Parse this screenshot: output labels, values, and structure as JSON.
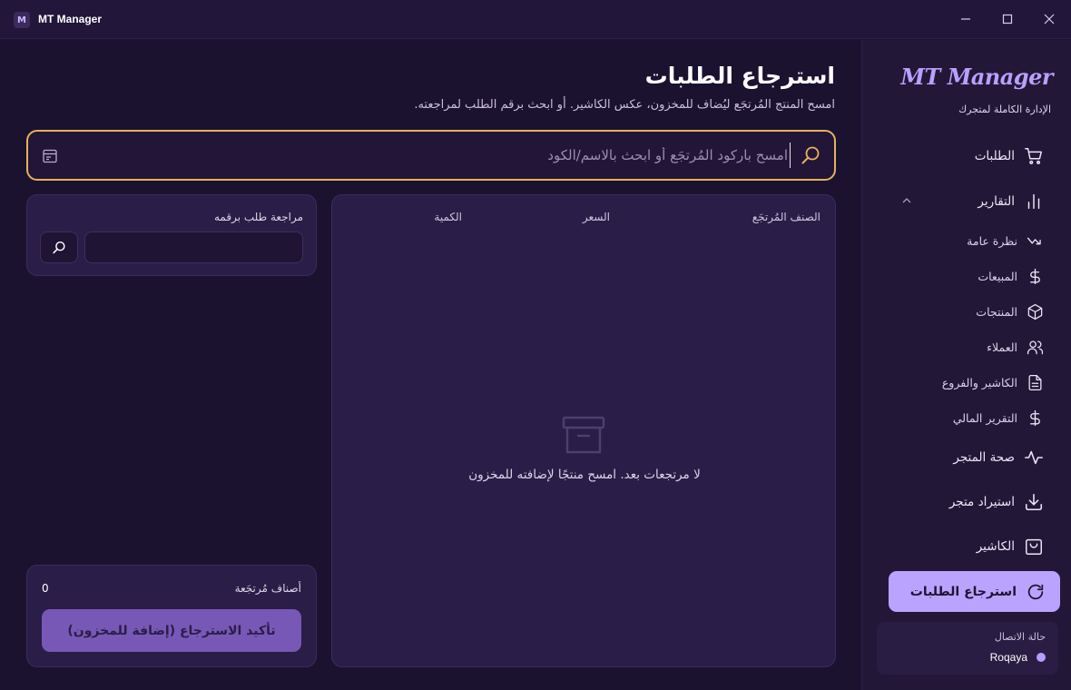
{
  "window": {
    "app_title": "MT Manager",
    "logo_letter": "M"
  },
  "page": {
    "title": "استرجاع الطلبات",
    "subtitle": "امسح المنتج المُرتجَع ليُضاف للمخزون، عكس الكاشير. أو ابحث برقم الطلب لمراجعته."
  },
  "scan": {
    "placeholder": "امسح باركود المُرتجَع أو ابحث بالاسم/الكود",
    "value": ""
  },
  "items_table": {
    "columns": [
      "الصنف المُرتجَع",
      "السعر",
      "الكمية"
    ],
    "rows": [],
    "empty_text": "لا مرتجعات بعد. امسح منتجًا لإضافته للمخزون"
  },
  "lookup": {
    "label": "مراجعة طلب برقمه",
    "value": ""
  },
  "summary": {
    "label": "أصناف مُرتجَعة",
    "count": "0",
    "confirm_label": "تأكيد الاسترجاع (إضافة للمخزون)"
  },
  "sidebar": {
    "brand": "MT Manager",
    "tagline": "الإدارة الكاملة لمتجرك",
    "items": [
      {
        "label": "الطلبات",
        "icon": "cart-icon"
      },
      {
        "label": "التقارير",
        "icon": "bar-chart-icon"
      },
      {
        "label": "نظرة عامة",
        "icon": "trend-icon"
      },
      {
        "label": "المبيعات",
        "icon": "dollar-icon"
      },
      {
        "label": "المنتجات",
        "icon": "box-icon"
      },
      {
        "label": "العملاء",
        "icon": "users-icon"
      },
      {
        "label": "الكاشير والفروع",
        "icon": "document-icon"
      },
      {
        "label": "التقرير المالي",
        "icon": "dollar-icon"
      },
      {
        "label": "صحة المتجر",
        "icon": "activity-icon"
      },
      {
        "label": "استيراد متجر",
        "icon": "download-icon"
      },
      {
        "label": "الكاشير",
        "icon": "bag-icon"
      }
    ],
    "active_item": {
      "label": "استرجاع الطلبات",
      "icon": "refresh-icon"
    },
    "connection": {
      "label": "حالة الاتصال",
      "user": "Roqaya",
      "status_color": "#b79dff"
    }
  },
  "colors": {
    "accent": "#b9a3ff",
    "scan_border": "#e5b25d",
    "confirm_button": "#7858b6",
    "background": "#1b1230"
  }
}
